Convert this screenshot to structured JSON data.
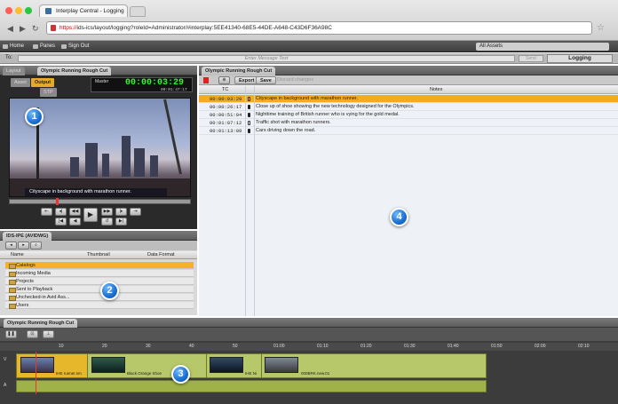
{
  "browser": {
    "tab_title": "Interplay Central - Logging",
    "url_scheme": "https://",
    "url_rest": "ids-ics/layout/logging?roleId=Administrator/#interplay:5EE41340-68E5-44DE-A648-C43D6F36A98C"
  },
  "appbar": {
    "home": "Home",
    "panes": "Panes",
    "sign_out": "Sign Out",
    "assets": "All Assets"
  },
  "messagebar": {
    "to_label": "To:",
    "placeholder": "Enter Message Text",
    "send": "Send",
    "mode": "Logging"
  },
  "player": {
    "tab_layout": "Layout",
    "tab_title": "Olympic Running Rough Cut",
    "asset_btn": "Asset",
    "output_btn": "Output",
    "str_btn": "STP",
    "master_label": "Master",
    "timecode": "00:00:03:29",
    "sub_timecode": "00:01:47:17",
    "caption": "Cityscape in background with marathon runner."
  },
  "ids": {
    "tab_title": "IDS-IPE (AVIDWG)",
    "columns": [
      "Name",
      "Thumbnail",
      "Data Format"
    ],
    "rows": [
      "Catalogs",
      "Incoming Media",
      "Projects",
      "Sent to Playback",
      "Unchecked-in Avid Ass...",
      "Users"
    ]
  },
  "logging": {
    "tab_title": "Olympic Running Rough Cut",
    "export_btn": "Export",
    "save_btn": "Save",
    "discard_btn": "Discard changes",
    "col_tc": "TC",
    "col_notes": "Notes",
    "rows": [
      {
        "tc": "00:00:03:29",
        "note": "Cityscape in background with marathon runner."
      },
      {
        "tc": "00:00:26:17",
        "note": "Close up of shoe showing the new technology designed for the Olympics."
      },
      {
        "tc": "00:00:51:04",
        "note": "Nighttime training of British runner who is vying for the gold medal."
      },
      {
        "tc": "00:01:07:12",
        "note": "Traffic shot with marathon runners."
      },
      {
        "tc": "00:01:13:09",
        "note": "Cars driving down the road."
      }
    ]
  },
  "timeline": {
    "tab_title": "Olympic Running Rough Cut",
    "ruler": [
      "10",
      "20",
      "30",
      "40",
      "50",
      "01:00",
      "01:10",
      "01:20",
      "01:30",
      "01:40",
      "01:50",
      "02:00",
      "02:10"
    ],
    "clips": [
      "IHE runner.sm",
      "Black Orange Shoe",
      "IHE Ni",
      "000BRK.new.01"
    ]
  },
  "badges": [
    "1",
    "2",
    "3",
    "4"
  ],
  "colors": {
    "accent": "#f2ad1f",
    "timecode": "#22ff22",
    "badge": "#1a70d0",
    "clip": "#b7c86a"
  }
}
